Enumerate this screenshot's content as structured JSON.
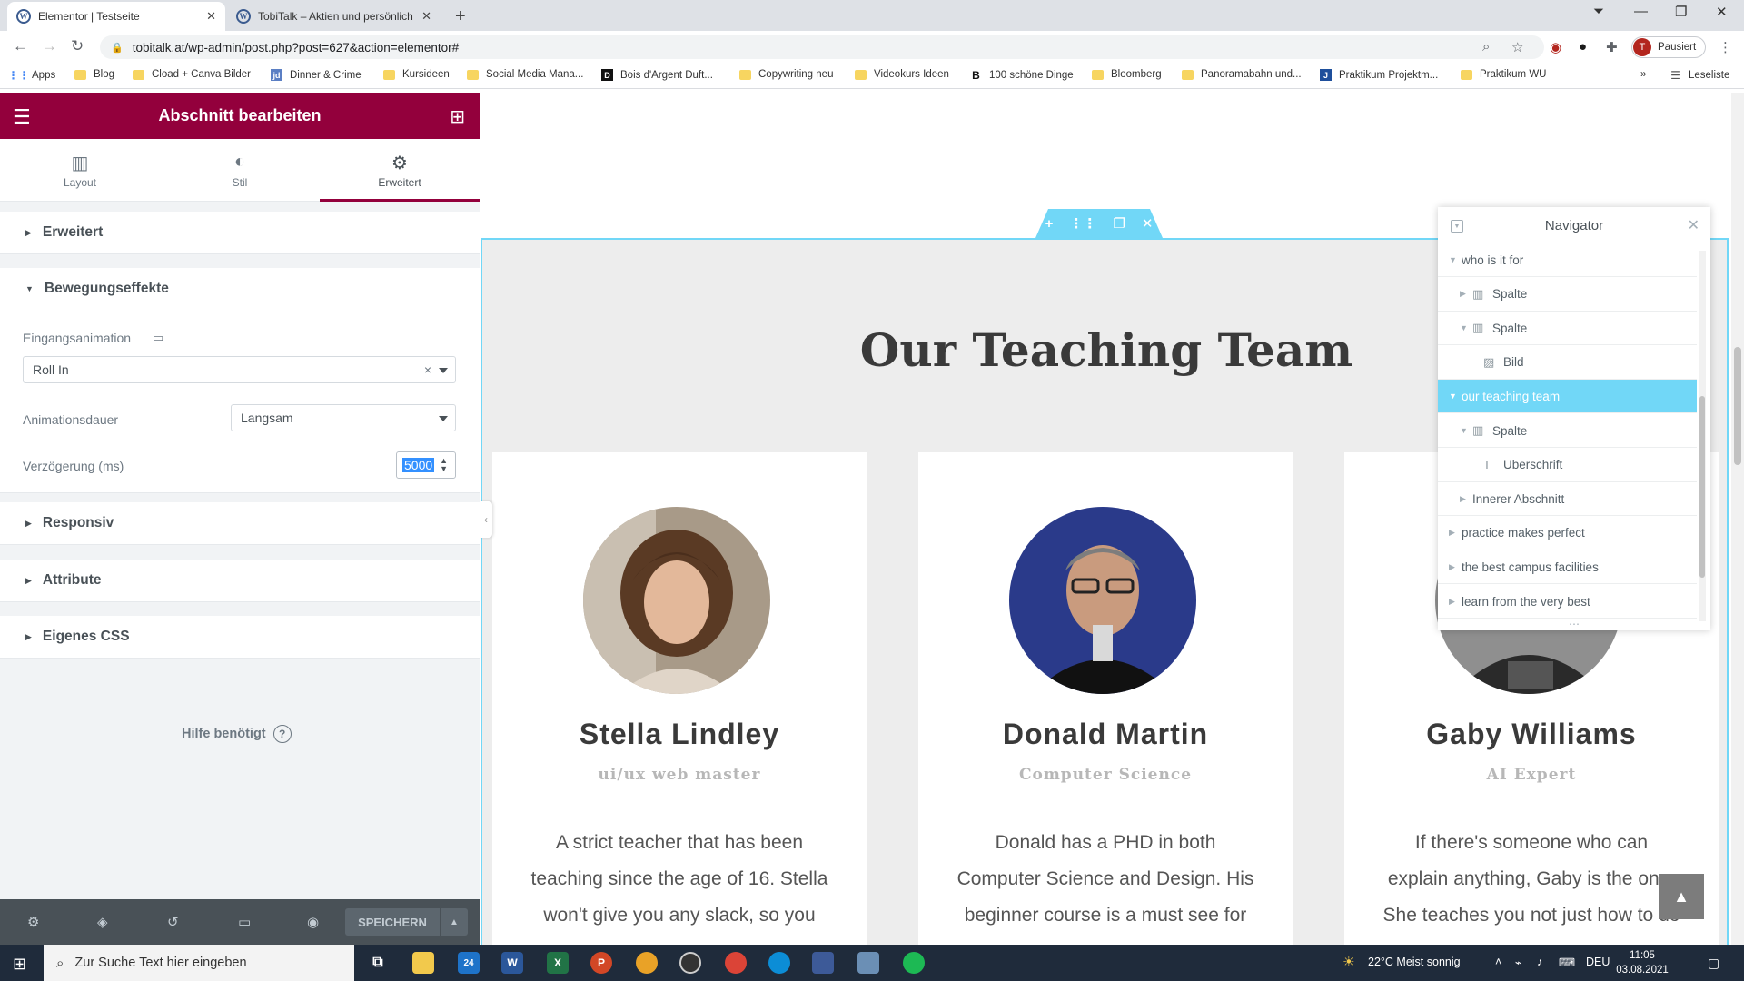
{
  "browser": {
    "tabs": [
      {
        "title": "Elementor | Testseite",
        "active": true
      },
      {
        "title": "TobiTalk – Aktien und persönlich",
        "active": false
      }
    ],
    "url": "tobitalk.at/wp-admin/post.php?post=627&action=elementor#",
    "profile_initial": "T",
    "profile_label": "Pausiert",
    "bookmarks": [
      "Apps",
      "Blog",
      "Cload + Canva Bilder",
      "Dinner & Crime",
      "Kursideen",
      "Social Media Mana...",
      "Bois d'Argent Duft...",
      "Copywriting neu",
      "Videokurs Ideen",
      "100 schöne Dinge",
      "Bloomberg",
      "Panoramabahn und...",
      "Praktikum Projektm...",
      "Praktikum WU"
    ],
    "reading_list": "Leseliste",
    "more": "»"
  },
  "panel": {
    "title": "Abschnitt bearbeiten",
    "tabs": [
      {
        "label": "Layout",
        "icon": "layout-icon"
      },
      {
        "label": "Stil",
        "icon": "contrast-icon"
      },
      {
        "label": "Erweitert",
        "icon": "gear-icon"
      }
    ],
    "sections": {
      "advanced": "Erweitert",
      "motion": "Bewegungseffekte",
      "responsive": "Responsiv",
      "attributes": "Attribute",
      "custom_css": "Eigenes CSS"
    },
    "entrance_label": "Eingangsanimation",
    "entrance_value": "Roll In",
    "duration_label": "Animationsdauer",
    "duration_value": "Langsam",
    "delay_label": "Verzögerung (ms)",
    "delay_value": "5000",
    "help": "Hilfe benötigt",
    "save": "SPEICHERN"
  },
  "canvas": {
    "heading": "Our Teaching Team",
    "team": [
      {
        "name": "Stella Lindley",
        "role": "ui/ux web master",
        "desc": [
          "A strict teacher that has been",
          "teaching since the age of 16. Stella",
          "won't give you any slack, so you"
        ]
      },
      {
        "name": "Donald Martin",
        "role": "Computer Science",
        "desc": [
          "Donald has a PHD in both",
          "Computer Science and Design. His",
          "beginner course is a must see for"
        ]
      },
      {
        "name": "Gaby Williams",
        "role": "AI Expert",
        "desc": [
          "If there's someone who can",
          "explain anything, Gaby is the one.",
          "She teaches you not just how to do"
        ]
      }
    ]
  },
  "navigator": {
    "title": "Navigator",
    "items": [
      {
        "label": "who is it for",
        "icon": "",
        "indent": 0,
        "arrow": "down",
        "highlight": false
      },
      {
        "label": "Spalte",
        "icon": "column-icon",
        "indent": 1,
        "arrow": "right",
        "highlight": false
      },
      {
        "label": "Spalte",
        "icon": "column-icon",
        "indent": 1,
        "arrow": "down",
        "highlight": false
      },
      {
        "label": "Bild",
        "icon": "image-icon",
        "indent": 2,
        "arrow": "",
        "highlight": false
      },
      {
        "label": "our teaching team",
        "icon": "",
        "indent": 0,
        "arrow": "down",
        "highlight": true
      },
      {
        "label": "Spalte",
        "icon": "column-icon",
        "indent": 1,
        "arrow": "down",
        "highlight": false
      },
      {
        "label": "Uberschrift",
        "icon": "heading-icon",
        "indent": 2,
        "arrow": "",
        "highlight": false
      },
      {
        "label": "Innerer Abschnitt",
        "icon": "",
        "indent": 1,
        "arrow": "right",
        "highlight": false
      },
      {
        "label": "practice makes perfect",
        "icon": "",
        "indent": 0,
        "arrow": "right",
        "highlight": false
      },
      {
        "label": "the best campus facilities",
        "icon": "",
        "indent": 0,
        "arrow": "right",
        "highlight": false
      },
      {
        "label": "learn from the very best",
        "icon": "",
        "indent": 0,
        "arrow": "right",
        "highlight": false
      }
    ]
  },
  "taskbar": {
    "search_placeholder": "Zur Suche Text hier eingeben",
    "weather": "22°C  Meist sonnig",
    "lang": "DEU",
    "time": "11:05",
    "date": "03.08.2021",
    "mail_badge": "24"
  },
  "colors": {
    "brand": "#93003c",
    "accent": "#71d7f7"
  }
}
